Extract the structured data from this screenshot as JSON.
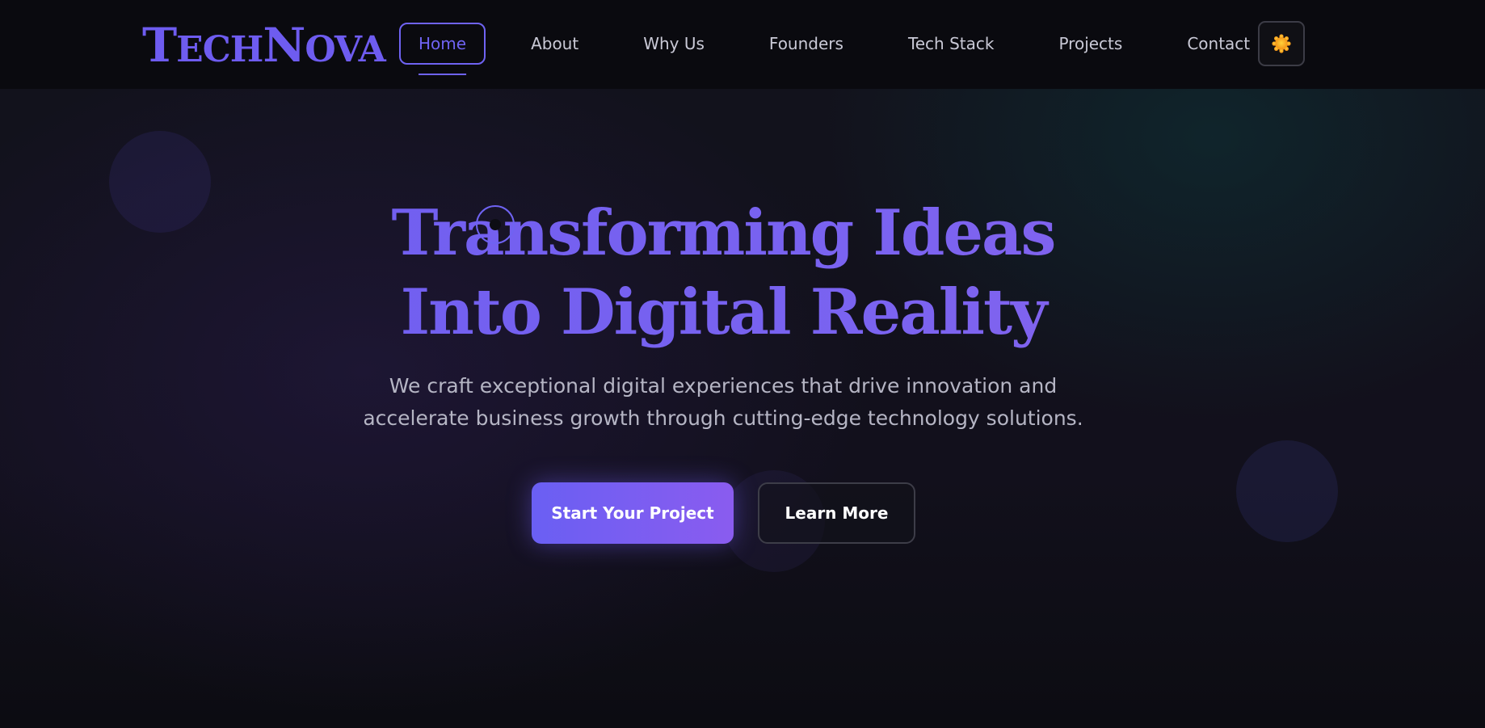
{
  "brand": {
    "logo_text_first": "T",
    "logo_text_rest": "ECH",
    "logo_text_second": "N",
    "logo_text_second_rest": "OVA"
  },
  "nav": {
    "items": [
      {
        "label": "Home",
        "active": true
      },
      {
        "label": "About"
      },
      {
        "label": "Why Us"
      },
      {
        "label": "Founders"
      },
      {
        "label": "Tech Stack"
      },
      {
        "label": "Projects"
      },
      {
        "label": "Contact"
      }
    ],
    "theme_toggle_icon": "sun-icon"
  },
  "hero": {
    "title_line1": "Transforming Ideas",
    "title_line2": "Into Digital Reality",
    "subtitle": "We craft exceptional digital experiences that drive innovation and accelerate business growth through cutting-edge technology solutions.",
    "primary_cta": "Start Your Project",
    "secondary_cta": "Learn More"
  },
  "colors": {
    "accent": "#6f63f2",
    "accent_end": "#8a5cef",
    "background": "#0c0c13",
    "sun": "#f7a81b"
  }
}
